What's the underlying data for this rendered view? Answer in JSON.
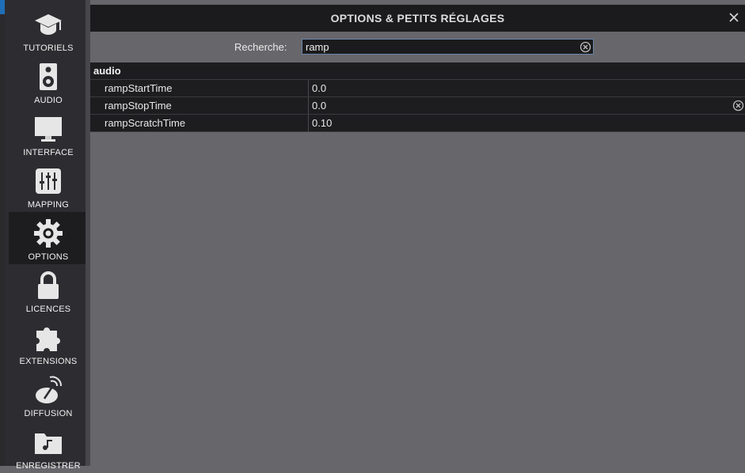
{
  "window": {
    "title": "OPTIONS & PETITS RÉGLAGES"
  },
  "sidebar": {
    "items": [
      {
        "label": "TUTORIELS",
        "icon": "graduation-cap-icon",
        "active": false
      },
      {
        "label": "AUDIO",
        "icon": "speaker-icon",
        "active": false
      },
      {
        "label": "INTERFACE",
        "icon": "monitor-icon",
        "active": false
      },
      {
        "label": "MAPPING",
        "icon": "sliders-icon",
        "active": false
      },
      {
        "label": "OPTIONS",
        "icon": "gear-icon",
        "active": true
      },
      {
        "label": "LICENCES",
        "icon": "lock-icon",
        "active": false
      },
      {
        "label": "EXTENSIONS",
        "icon": "puzzle-icon",
        "active": false
      },
      {
        "label": "DIFFUSION",
        "icon": "broadcast-icon",
        "active": false
      },
      {
        "label": "ENREGISTRER",
        "icon": "music-folder-icon",
        "active": false
      }
    ]
  },
  "search": {
    "label": "Recherche:",
    "value": "ramp"
  },
  "table": {
    "group": "audio",
    "rows": [
      {
        "name": "rampStartTime",
        "value": "0.0"
      },
      {
        "name": "rampStopTime",
        "value": "0.0"
      },
      {
        "name": "rampScratchTime",
        "value": "0.10"
      }
    ]
  },
  "colors": {
    "background": "#67666b",
    "sidebar": "#2d2d31",
    "panel": "#1d1d20",
    "search_border": "#6a85a8"
  }
}
